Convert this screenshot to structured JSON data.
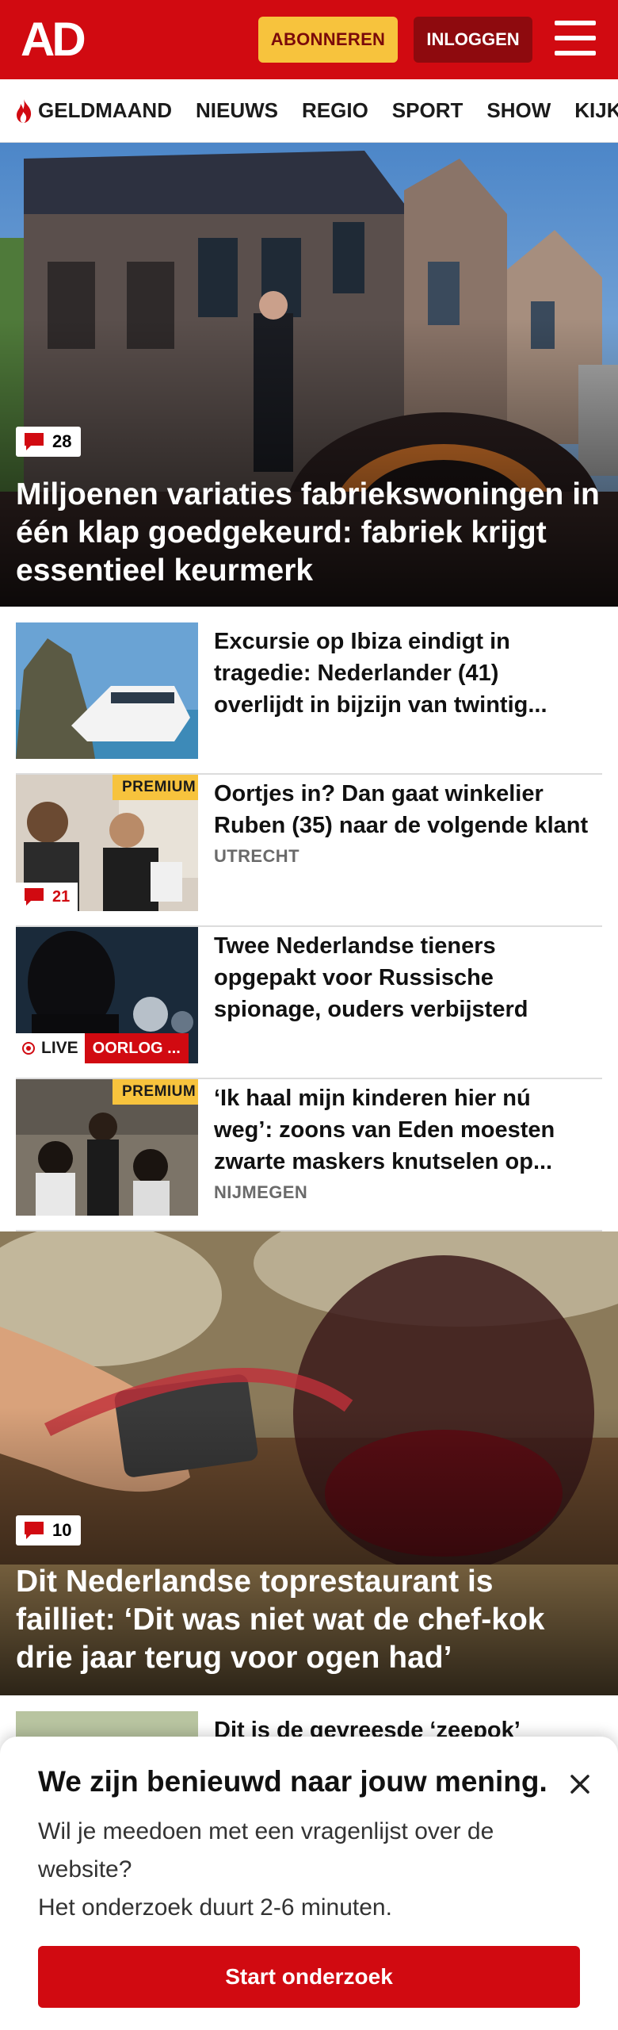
{
  "header": {
    "logo_text": "AD",
    "subscribe_label": "ABONNEREN",
    "login_label": "INLOGGEN",
    "brand_color": "#d10a11"
  },
  "nav": {
    "items": [
      "GELDMAAND",
      "NIEUWS",
      "REGIO",
      "SPORT",
      "SHOW",
      "KIJK"
    ]
  },
  "hero1": {
    "comments": "28",
    "title": "Miljoenen variaties fabriekswoningen in één klap goedgekeurd: fabriek krijgt essentieel keurmerk"
  },
  "articles": [
    {
      "title": "Excursie op Ibiza eindigt in tragedie: Nederlander (41) overlijdt in bijzijn van twintig...",
      "location": ""
    },
    {
      "title": "Oortjes in? Dan gaat winkelier Ruben (35) naar de volgende klant",
      "location": "UTRECHT",
      "badge": "PREMIUM",
      "comments": "21"
    },
    {
      "title": "Twee Nederlandse tieners opgepakt voor Russische spionage, ouders verbijsterd",
      "location": "",
      "live_label": "LIVE",
      "tag": "OORLOG ..."
    },
    {
      "title": "‘Ik haal mijn kinderen hier nú weg’: zoons van Eden moesten zwarte maskers knutselen op...",
      "location": "NIJMEGEN",
      "badge": "PREMIUM"
    }
  ],
  "hero2": {
    "comments": "10",
    "title": "Dit Nederlandse toprestaurant is failliet: ‘Dit was niet wat de chef-kok drie jaar terug voor ogen had’"
  },
  "next_article": {
    "title": "Dit is de gevreesde ‘zeepok’"
  },
  "survey": {
    "title": "We zijn benieuwd naar jouw mening.",
    "body_line1": "Wil je meedoen met een vragenlijst over de website?",
    "body_line2": "Het onderzoek duurt 2-6 minuten.",
    "button_label": "Start onderzoek"
  }
}
